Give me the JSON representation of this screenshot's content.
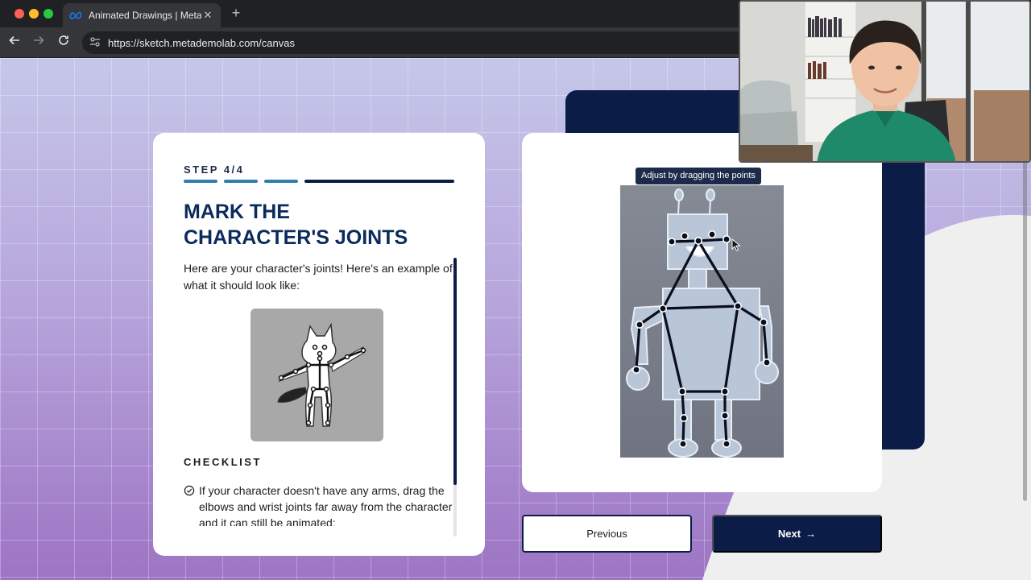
{
  "browser": {
    "tab_title": "Animated Drawings | Meta FA",
    "tab_close": "✕",
    "new_tab": "+",
    "url": "https://sketch.metademolab.com/canvas"
  },
  "left_card": {
    "step_label": "STEP 4/4",
    "progress": {
      "completed_steps": 3,
      "total_steps": 4
    },
    "title_line1": "MARK THE",
    "title_line2": "CHARACTER'S JOINTS",
    "intro": "Here are your character's joints! Here's an example of what it should look like:",
    "checklist_heading": "CHECKLIST",
    "checklist_items": [
      "If your character doesn't have any arms, drag the elbows and wrist joints far away from the character and it can still be animated:"
    ]
  },
  "canvas": {
    "tooltip": "Adjust by dragging the points"
  },
  "buttons": {
    "previous": "Previous",
    "next": "Next",
    "next_arrow": "→"
  },
  "colors": {
    "navy": "#0b1d47",
    "progress_done": "#2f7fae",
    "title": "#0b2b5c"
  },
  "icons": {
    "back": "arrow-left-icon",
    "forward": "arrow-right-icon",
    "reload": "reload-icon",
    "site_info": "tune-icon",
    "check": "check-circle-icon"
  }
}
